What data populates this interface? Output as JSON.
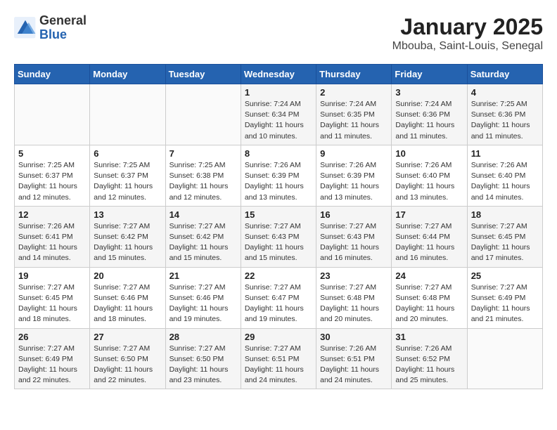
{
  "header": {
    "logo_general": "General",
    "logo_blue": "Blue",
    "month_year": "January 2025",
    "location": "Mbouba, Saint-Louis, Senegal"
  },
  "days_of_week": [
    "Sunday",
    "Monday",
    "Tuesday",
    "Wednesday",
    "Thursday",
    "Friday",
    "Saturday"
  ],
  "weeks": [
    [
      {
        "day": "",
        "sunrise": "",
        "sunset": "",
        "daylight": ""
      },
      {
        "day": "",
        "sunrise": "",
        "sunset": "",
        "daylight": ""
      },
      {
        "day": "",
        "sunrise": "",
        "sunset": "",
        "daylight": ""
      },
      {
        "day": "1",
        "sunrise": "Sunrise: 7:24 AM",
        "sunset": "Sunset: 6:34 PM",
        "daylight": "Daylight: 11 hours and 10 minutes."
      },
      {
        "day": "2",
        "sunrise": "Sunrise: 7:24 AM",
        "sunset": "Sunset: 6:35 PM",
        "daylight": "Daylight: 11 hours and 11 minutes."
      },
      {
        "day": "3",
        "sunrise": "Sunrise: 7:24 AM",
        "sunset": "Sunset: 6:36 PM",
        "daylight": "Daylight: 11 hours and 11 minutes."
      },
      {
        "day": "4",
        "sunrise": "Sunrise: 7:25 AM",
        "sunset": "Sunset: 6:36 PM",
        "daylight": "Daylight: 11 hours and 11 minutes."
      }
    ],
    [
      {
        "day": "5",
        "sunrise": "Sunrise: 7:25 AM",
        "sunset": "Sunset: 6:37 PM",
        "daylight": "Daylight: 11 hours and 12 minutes."
      },
      {
        "day": "6",
        "sunrise": "Sunrise: 7:25 AM",
        "sunset": "Sunset: 6:37 PM",
        "daylight": "Daylight: 11 hours and 12 minutes."
      },
      {
        "day": "7",
        "sunrise": "Sunrise: 7:25 AM",
        "sunset": "Sunset: 6:38 PM",
        "daylight": "Daylight: 11 hours and 12 minutes."
      },
      {
        "day": "8",
        "sunrise": "Sunrise: 7:26 AM",
        "sunset": "Sunset: 6:39 PM",
        "daylight": "Daylight: 11 hours and 13 minutes."
      },
      {
        "day": "9",
        "sunrise": "Sunrise: 7:26 AM",
        "sunset": "Sunset: 6:39 PM",
        "daylight": "Daylight: 11 hours and 13 minutes."
      },
      {
        "day": "10",
        "sunrise": "Sunrise: 7:26 AM",
        "sunset": "Sunset: 6:40 PM",
        "daylight": "Daylight: 11 hours and 13 minutes."
      },
      {
        "day": "11",
        "sunrise": "Sunrise: 7:26 AM",
        "sunset": "Sunset: 6:40 PM",
        "daylight": "Daylight: 11 hours and 14 minutes."
      }
    ],
    [
      {
        "day": "12",
        "sunrise": "Sunrise: 7:26 AM",
        "sunset": "Sunset: 6:41 PM",
        "daylight": "Daylight: 11 hours and 14 minutes."
      },
      {
        "day": "13",
        "sunrise": "Sunrise: 7:27 AM",
        "sunset": "Sunset: 6:42 PM",
        "daylight": "Daylight: 11 hours and 15 minutes."
      },
      {
        "day": "14",
        "sunrise": "Sunrise: 7:27 AM",
        "sunset": "Sunset: 6:42 PM",
        "daylight": "Daylight: 11 hours and 15 minutes."
      },
      {
        "day": "15",
        "sunrise": "Sunrise: 7:27 AM",
        "sunset": "Sunset: 6:43 PM",
        "daylight": "Daylight: 11 hours and 15 minutes."
      },
      {
        "day": "16",
        "sunrise": "Sunrise: 7:27 AM",
        "sunset": "Sunset: 6:43 PM",
        "daylight": "Daylight: 11 hours and 16 minutes."
      },
      {
        "day": "17",
        "sunrise": "Sunrise: 7:27 AM",
        "sunset": "Sunset: 6:44 PM",
        "daylight": "Daylight: 11 hours and 16 minutes."
      },
      {
        "day": "18",
        "sunrise": "Sunrise: 7:27 AM",
        "sunset": "Sunset: 6:45 PM",
        "daylight": "Daylight: 11 hours and 17 minutes."
      }
    ],
    [
      {
        "day": "19",
        "sunrise": "Sunrise: 7:27 AM",
        "sunset": "Sunset: 6:45 PM",
        "daylight": "Daylight: 11 hours and 18 minutes."
      },
      {
        "day": "20",
        "sunrise": "Sunrise: 7:27 AM",
        "sunset": "Sunset: 6:46 PM",
        "daylight": "Daylight: 11 hours and 18 minutes."
      },
      {
        "day": "21",
        "sunrise": "Sunrise: 7:27 AM",
        "sunset": "Sunset: 6:46 PM",
        "daylight": "Daylight: 11 hours and 19 minutes."
      },
      {
        "day": "22",
        "sunrise": "Sunrise: 7:27 AM",
        "sunset": "Sunset: 6:47 PM",
        "daylight": "Daylight: 11 hours and 19 minutes."
      },
      {
        "day": "23",
        "sunrise": "Sunrise: 7:27 AM",
        "sunset": "Sunset: 6:48 PM",
        "daylight": "Daylight: 11 hours and 20 minutes."
      },
      {
        "day": "24",
        "sunrise": "Sunrise: 7:27 AM",
        "sunset": "Sunset: 6:48 PM",
        "daylight": "Daylight: 11 hours and 20 minutes."
      },
      {
        "day": "25",
        "sunrise": "Sunrise: 7:27 AM",
        "sunset": "Sunset: 6:49 PM",
        "daylight": "Daylight: 11 hours and 21 minutes."
      }
    ],
    [
      {
        "day": "26",
        "sunrise": "Sunrise: 7:27 AM",
        "sunset": "Sunset: 6:49 PM",
        "daylight": "Daylight: 11 hours and 22 minutes."
      },
      {
        "day": "27",
        "sunrise": "Sunrise: 7:27 AM",
        "sunset": "Sunset: 6:50 PM",
        "daylight": "Daylight: 11 hours and 22 minutes."
      },
      {
        "day": "28",
        "sunrise": "Sunrise: 7:27 AM",
        "sunset": "Sunset: 6:50 PM",
        "daylight": "Daylight: 11 hours and 23 minutes."
      },
      {
        "day": "29",
        "sunrise": "Sunrise: 7:27 AM",
        "sunset": "Sunset: 6:51 PM",
        "daylight": "Daylight: 11 hours and 24 minutes."
      },
      {
        "day": "30",
        "sunrise": "Sunrise: 7:26 AM",
        "sunset": "Sunset: 6:51 PM",
        "daylight": "Daylight: 11 hours and 24 minutes."
      },
      {
        "day": "31",
        "sunrise": "Sunrise: 7:26 AM",
        "sunset": "Sunset: 6:52 PM",
        "daylight": "Daylight: 11 hours and 25 minutes."
      },
      {
        "day": "",
        "sunrise": "",
        "sunset": "",
        "daylight": ""
      }
    ]
  ]
}
